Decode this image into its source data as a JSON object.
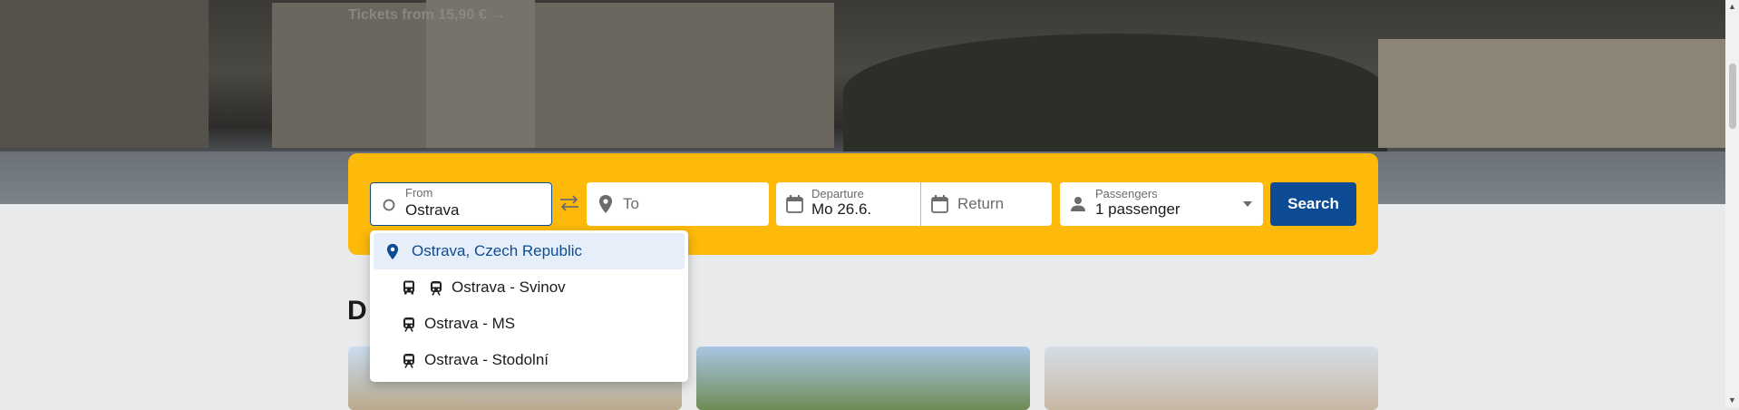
{
  "hero": {
    "promo_text": "Tickets from 15,90 € →"
  },
  "search": {
    "from": {
      "label": "From",
      "value": "Ostrava"
    },
    "to": {
      "placeholder": "To"
    },
    "departure": {
      "label": "Departure",
      "value": "Mo 26.6."
    },
    "return": {
      "placeholder": "Return"
    },
    "passengers": {
      "label": "Passengers",
      "value": "1 passenger"
    },
    "search_label": "Search"
  },
  "suggestions": [
    {
      "label": "Ostrava, Czech Republic",
      "icons": [
        "location-pin-icon"
      ],
      "highlighted": true
    },
    {
      "label": "Ostrava - Svinov",
      "icons": [
        "bus-icon",
        "train-icon"
      ]
    },
    {
      "label": "Ostrava - MS",
      "icons": [
        "train-icon"
      ]
    },
    {
      "label": "Ostrava - Stodolní",
      "icons": [
        "train-icon"
      ]
    }
  ],
  "section": {
    "heading_partial": "D"
  },
  "colors": {
    "accent_yellow": "#fdba0a",
    "primary_blue": "#0d4c94",
    "highlight": "#e6eff9"
  }
}
